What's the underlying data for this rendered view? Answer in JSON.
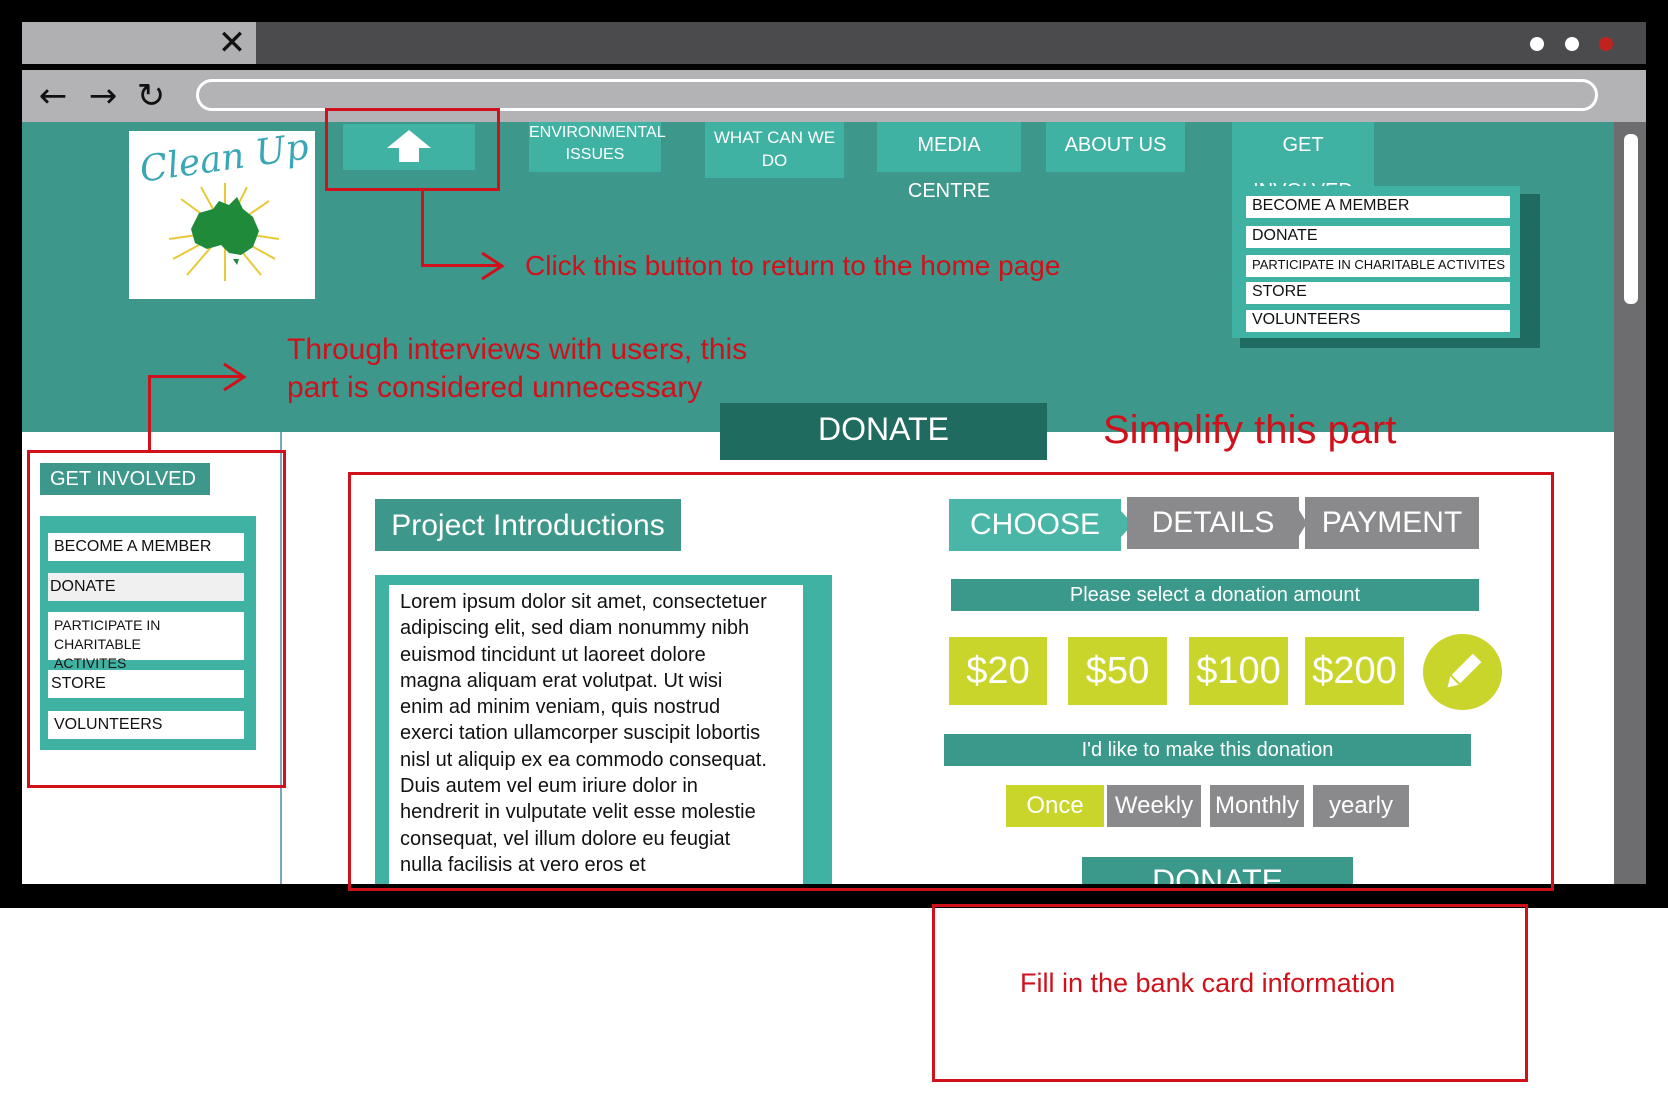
{
  "browser": {
    "close_glyph": "✕",
    "back_glyph": "←",
    "forward_glyph": "→",
    "reload_glyph": "↻",
    "dot_colors": [
      "#ffffff",
      "#ffffff",
      "#c0231d"
    ]
  },
  "logo": {
    "text": "Clean Up"
  },
  "topnav": {
    "home_icon": "home-arrow-icon",
    "env_line1": "ENVIRONMENTAL",
    "env_line2": "ISSUES",
    "what_line1": "WHAT CAN WE",
    "what_line2": "DO",
    "media": "MEDIA CENTRE",
    "about": "ABOUT US",
    "involved": "GET INVOLVED"
  },
  "dropdown": [
    "BECOME A MEMBER",
    "DONATE",
    "PARTICIPATE IN CHARITABLE ACTIVITES",
    "STORE",
    "VOLUNTEERS"
  ],
  "annotations": {
    "home": "Click this button to return to the home page",
    "unnecessary_line1": "Through interviews with users, this",
    "unnecessary_line2": "part is considered unnecessary",
    "simplify": "Simplify this part",
    "bank": "Fill in the bank card information"
  },
  "page_title": "DONATE",
  "sidebar": {
    "title": "GET INVOLVED",
    "items": [
      "BECOME A MEMBER",
      "DONATE",
      "PARTICIPATE IN CHARITABLE",
      "ACTIVITES",
      "STORE",
      "VOLUNTEERS"
    ]
  },
  "project": {
    "title": "Project Introductions",
    "lines": [
      "Lorem ipsum dolor sit amet, consectetuer",
      "adipiscing elit, sed diam nonummy nibh",
      "euismod tincidunt ut laoreet dolore",
      "magna aliquam erat volutpat. Ut wisi",
      "enim ad minim veniam, quis nostrud",
      "exerci tation ullamcorper suscipit lobortis",
      "nisl ut aliquip ex ea commodo consequat.",
      "Duis autem vel eum iriure dolor in",
      "hendrerit in vulputate velit esse molestie",
      "consequat, vel illum dolore eu feugiat",
      "nulla facilisis at vero eros et"
    ]
  },
  "steps": [
    "CHOOSE",
    "DETAILS",
    "PAYMENT"
  ],
  "select_prompt": "Please select a donation amount",
  "amounts": [
    "$20",
    "$50",
    "$100",
    "$200"
  ],
  "edit_icon": "pencil-icon",
  "frequency_prompt": "I'd like to make this donation",
  "frequencies": [
    "Once",
    "Weekly",
    "Monthly",
    "yearly"
  ],
  "donate_button": "DONATE",
  "colors": {
    "teal": "#3d978b",
    "teal_light": "#40b2a3",
    "teal_dark": "#1f6b60",
    "lime": "#c9d52a",
    "gray": "#8a8a8c",
    "annotation_red": "#d0111b"
  }
}
